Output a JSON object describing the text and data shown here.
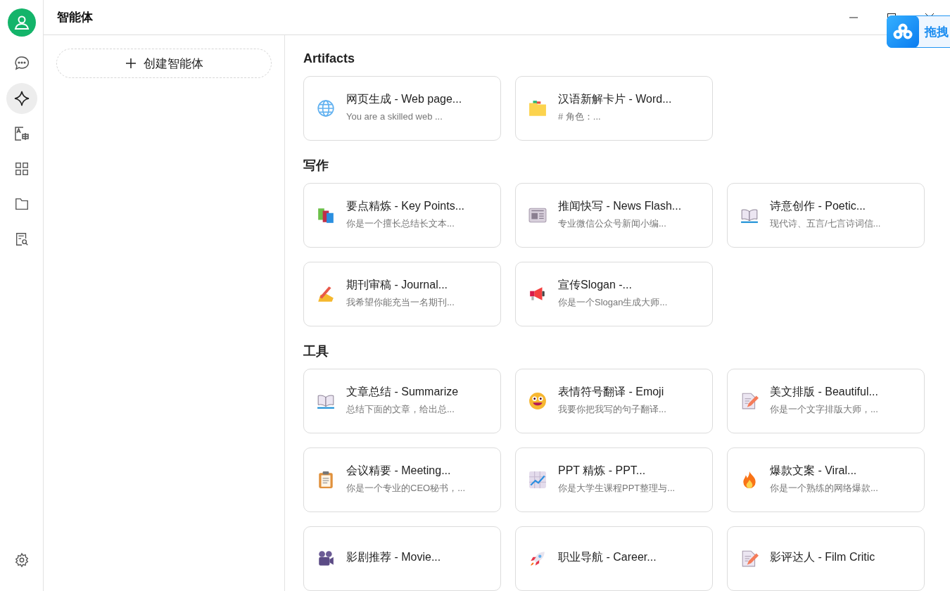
{
  "window": {
    "title": "智能体"
  },
  "rail": {
    "items": [
      {
        "kind": "chat",
        "selected": false
      },
      {
        "kind": "sparkle",
        "selected": true
      },
      {
        "kind": "translate",
        "selected": false
      },
      {
        "kind": "grid",
        "selected": false
      },
      {
        "kind": "folder",
        "selected": false
      },
      {
        "kind": "doc-search",
        "selected": false
      }
    ]
  },
  "create_button": {
    "label": "创建智能体"
  },
  "sections": [
    {
      "title": "Artifacts",
      "cards": [
        {
          "kind": "globe",
          "title": "网页生成 - Web page...",
          "description": "You are a skilled web ..."
        },
        {
          "kind": "folder",
          "title": "汉语新解卡片 - Word...",
          "description": "# 角色：..."
        }
      ]
    },
    {
      "title": "写作",
      "cards": [
        {
          "kind": "books",
          "title": "要点精炼 - Key Points...",
          "description": "你是一个擅长总结长文本..."
        },
        {
          "kind": "newspaper",
          "title": "推闻快写 - News Flash...",
          "description": "专业微信公众号新闻小编..."
        },
        {
          "kind": "book",
          "title": "诗意创作 - Poetic...",
          "description": "现代诗、五言/七言诗词信..."
        },
        {
          "kind": "pencil-hand",
          "title": "期刊审稿 - Journal...",
          "description": "我希望你能充当一名期刊..."
        },
        {
          "kind": "megaphone",
          "title": "宣传Slogan -...",
          "description": "你是一个Slogan生成大师..."
        }
      ]
    },
    {
      "title": "工具",
      "cards": [
        {
          "kind": "book",
          "title": "文章总结 - Summarize",
          "description": "总结下面的文章，给出总..."
        },
        {
          "kind": "smiley",
          "title": "表情符号翻译 - Emoji",
          "description": "我要你把我写的句子翻译..."
        },
        {
          "kind": "doc-pencil",
          "title": "美文排版 - Beautiful...",
          "description": "你是一个文字排版大师，..."
        },
        {
          "kind": "clipboard",
          "title": "会议精要 - Meeting...",
          "description": "你是一个专业的CEO秘书，..."
        },
        {
          "kind": "chart",
          "title": "PPT 精炼 - PPT...",
          "description": "你是大学生课程PPT整理与..."
        },
        {
          "kind": "fire",
          "title": "爆款文案 - Viral...",
          "description": "你是一个熟练的网络爆款..."
        },
        {
          "kind": "camera",
          "title": "影剧推荐 - Movie..."
        },
        {
          "kind": "rocket",
          "title": "职业导航 - Career..."
        },
        {
          "kind": "doc-pencil",
          "title": "影评达人 - Film Critic"
        }
      ]
    }
  ],
  "drop_widget": {
    "label": "拖拽"
  }
}
